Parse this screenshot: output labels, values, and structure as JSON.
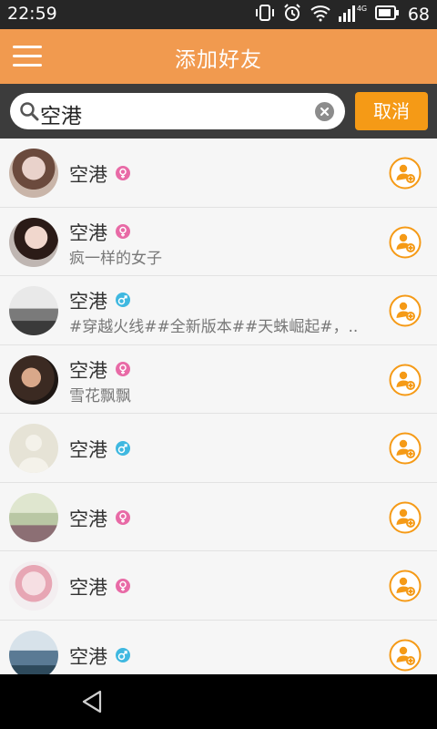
{
  "status_bar": {
    "time": "22:59",
    "network_label": "4G",
    "battery_level": "68",
    "icons": [
      "vibrate-icon",
      "alarm-icon",
      "wifi-icon",
      "signal-icon",
      "battery-icon"
    ]
  },
  "header": {
    "title": "添加好友",
    "menu_icon": "menu-icon"
  },
  "search": {
    "query": "空港",
    "cancel_label": "取消"
  },
  "colors": {
    "header": "#f19a4f",
    "cancel_button": "#f59a16",
    "female": "#e86aa6",
    "male": "#3fb8e0",
    "add_button": "#f59a16"
  },
  "results": [
    {
      "name": "空港",
      "gender": "female",
      "signature": ""
    },
    {
      "name": "空港",
      "gender": "female",
      "signature": "疯一样的女子"
    },
    {
      "name": "空港",
      "gender": "male",
      "signature": "#穿越火线##全新版本##天蛛崛起#，.."
    },
    {
      "name": "空港",
      "gender": "female",
      "signature": "雪花飘飘"
    },
    {
      "name": "空港",
      "gender": "male",
      "signature": ""
    },
    {
      "name": "空港",
      "gender": "female",
      "signature": ""
    },
    {
      "name": "空港",
      "gender": "female",
      "signature": ""
    },
    {
      "name": "空港",
      "gender": "male",
      "signature": ""
    }
  ]
}
